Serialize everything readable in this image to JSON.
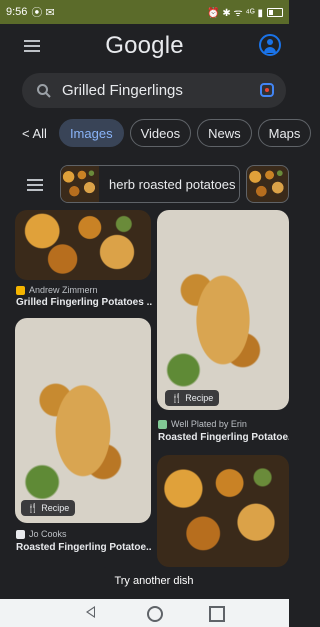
{
  "status_bar": {
    "time": "9:56",
    "icons_left": "⦿ ✉",
    "icons_right": "⏰ ✱ ᯤ ⁴ᴳ ▮"
  },
  "header": {
    "logo": "Google"
  },
  "search": {
    "query": "Grilled Fingerlings"
  },
  "tabs": [
    {
      "label": "< All"
    },
    {
      "label": "Images",
      "active": true
    },
    {
      "label": "Videos"
    },
    {
      "label": "News"
    },
    {
      "label": "Maps"
    }
  ],
  "filters": {
    "chip_label": "herb roasted potatoes"
  },
  "results": [
    {
      "source": "Andrew Zimmern",
      "title": "Grilled Fingerling Potatoes ..."
    },
    {
      "source": "Well Plated by Erin",
      "title": "Roasted Fingerling Potatoe...",
      "badge": "Recipe"
    },
    {
      "source": "Jo Cooks",
      "title": "Roasted Fingerling Potatoe...",
      "badge": "Recipe"
    }
  ],
  "toast": {
    "text": "Try another dish"
  },
  "colors": {
    "background": "#202124",
    "accent": "#8ab4f8",
    "status_bar": "#5b6b2a"
  }
}
